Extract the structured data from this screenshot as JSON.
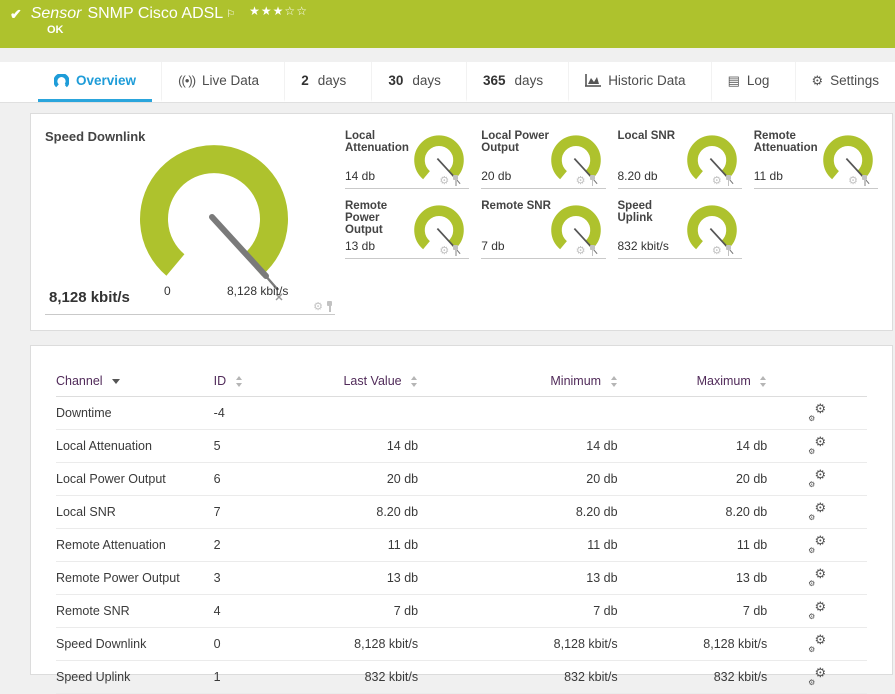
{
  "header": {
    "type_label": "Sensor",
    "title": "SNMP Cisco ADSL",
    "status": "OK",
    "stars": "★★★☆☆",
    "bar_color": "#aec22d"
  },
  "icons": {
    "check": "✔",
    "flag": "⚐",
    "gear": "⚙",
    "log": "▤",
    "broadcast": "((•))"
  },
  "tabs": {
    "overview": {
      "label": "Overview"
    },
    "live": {
      "label": "Live Data"
    },
    "d2": {
      "num": "2",
      "unit": "days"
    },
    "d30": {
      "num": "30",
      "unit": "days"
    },
    "d365": {
      "num": "365",
      "unit": "days"
    },
    "historic": {
      "label": "Historic Data"
    },
    "log": {
      "label": "Log"
    },
    "settings": {
      "label": "Settings"
    }
  },
  "gauges": {
    "primary": {
      "title": "Speed Downlink",
      "value": "8,128 kbit/s",
      "scale_min": "0",
      "scale_max": "8,128 kbit/s",
      "color": "#aec22d"
    },
    "minis": [
      {
        "title": "Local Attenuation",
        "value": "14 db"
      },
      {
        "title": "Local Power Output",
        "value": "20 db"
      },
      {
        "title": "Local SNR",
        "value": "8.20 db"
      },
      {
        "title": "Remote Attenuation",
        "value": "11 db"
      },
      {
        "title": "Remote Power Output",
        "value": "13 db"
      },
      {
        "title": "Remote SNR",
        "value": "7 db"
      },
      {
        "title": "Speed Uplink",
        "value": "832 kbit/s"
      }
    ]
  },
  "table": {
    "columns": {
      "channel": "Channel",
      "id": "ID",
      "last": "Last Value",
      "min": "Minimum",
      "max": "Maximum"
    },
    "rows": [
      {
        "channel": "Downtime",
        "id": "-4",
        "last": "",
        "min": "",
        "max": ""
      },
      {
        "channel": "Local Attenuation",
        "id": "5",
        "last": "14 db",
        "min": "14 db",
        "max": "14 db"
      },
      {
        "channel": "Local Power Output",
        "id": "6",
        "last": "20 db",
        "min": "20 db",
        "max": "20 db"
      },
      {
        "channel": "Local SNR",
        "id": "7",
        "last": "8.20 db",
        "min": "8.20 db",
        "max": "8.20 db"
      },
      {
        "channel": "Remote Attenuation",
        "id": "2",
        "last": "11 db",
        "min": "11 db",
        "max": "11 db"
      },
      {
        "channel": "Remote Power Output",
        "id": "3",
        "last": "13 db",
        "min": "13 db",
        "max": "13 db"
      },
      {
        "channel": "Remote SNR",
        "id": "4",
        "last": "7 db",
        "min": "7 db",
        "max": "7 db"
      },
      {
        "channel": "Speed Downlink",
        "id": "0",
        "last": "8,128 kbit/s",
        "min": "8,128 kbit/s",
        "max": "8,128 kbit/s"
      },
      {
        "channel": "Speed Uplink",
        "id": "1",
        "last": "832 kbit/s",
        "min": "832 kbit/s",
        "max": "832 kbit/s"
      }
    ]
  }
}
